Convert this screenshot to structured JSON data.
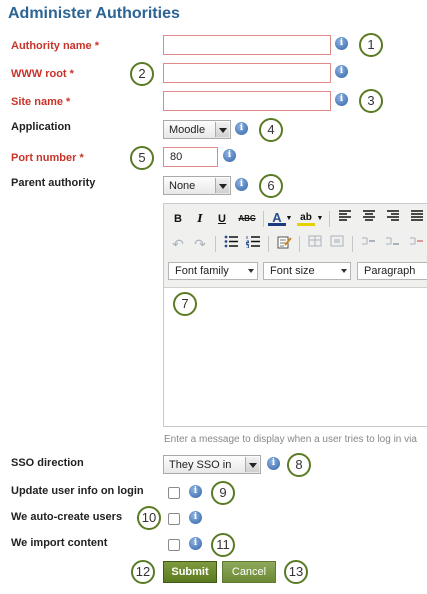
{
  "page": {
    "title": "Administer Authorities"
  },
  "fields": {
    "authority_name": {
      "label": "Authority name *",
      "value": ""
    },
    "www_root": {
      "label": "WWW root *",
      "value": ""
    },
    "site_name": {
      "label": "Site name *",
      "value": ""
    },
    "application": {
      "label": "Application",
      "selected": "Moodle"
    },
    "port_number": {
      "label": "Port number *",
      "value": "80"
    },
    "parent_authority": {
      "label": "Parent authority",
      "selected": "None"
    },
    "sso_direction": {
      "label": "SSO direction",
      "selected": "They SSO in"
    },
    "update_user_info": {
      "label": "Update user info on login",
      "checked": false
    },
    "auto_create_users": {
      "label": "We auto-create users",
      "checked": false
    },
    "import_content": {
      "label": "We import content",
      "checked": false
    }
  },
  "editor": {
    "font_family": "Font family",
    "font_size": "Font size",
    "paragraph": "Paragraph",
    "hint": "Enter a message to display when a user tries to log in via"
  },
  "buttons": {
    "submit": "Submit",
    "cancel": "Cancel"
  },
  "info_glyph": "i",
  "callouts": [
    "1",
    "2",
    "3",
    "4",
    "5",
    "6",
    "7",
    "8",
    "9",
    "10",
    "11",
    "12",
    "13"
  ],
  "colors": {
    "title": "#2c6494",
    "required_label": "#c8332a",
    "button": "#5b7a1f",
    "callout_border": "#5a7a24"
  }
}
